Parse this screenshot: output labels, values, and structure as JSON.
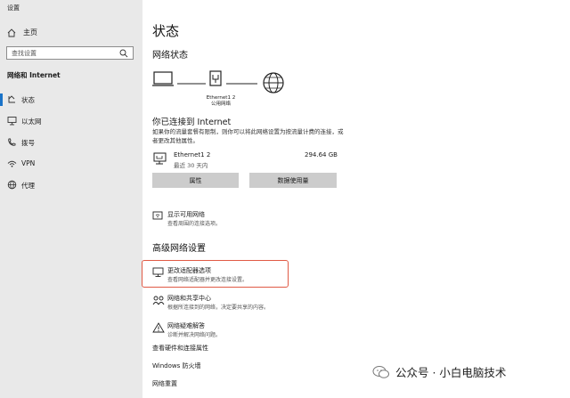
{
  "app": {
    "title": "设置"
  },
  "sidebar": {
    "home_label": "主页",
    "search_placeholder": "查找设置",
    "section_label": "网络和 Internet",
    "items": [
      {
        "label": "状态",
        "icon": "home-status-icon",
        "active": true
      },
      {
        "label": "以太网",
        "icon": "ethernet-icon",
        "active": false
      },
      {
        "label": "拨号",
        "icon": "dialup-phone-icon",
        "active": false
      },
      {
        "label": "VPN",
        "icon": "vpn-icon",
        "active": false
      },
      {
        "label": "代理",
        "icon": "proxy-globe-icon",
        "active": false
      }
    ]
  },
  "main": {
    "title": "状态",
    "network_status_heading": "网络状态",
    "diagram": {
      "adapter_name": "Ethernet1 2",
      "network_type": "公用网络"
    },
    "connected_title": "你已连接到 Internet",
    "connected_desc": "如果你的流量套餐有限制，则你可以将此网络设置为按流量计费的连接，或者更改其他属性。",
    "adapter": {
      "name": "Ethernet1 2",
      "sub": "最近 30 天内",
      "usage": "294.64 GB"
    },
    "buttons": {
      "properties": "属性",
      "data_usage": "数据使用量"
    },
    "show_networks": {
      "title": "显示可用网络",
      "sub": "查看周围的连接选项。"
    },
    "advanced_heading": "高级网络设置",
    "change_adapter": {
      "title": "更改适配器选项",
      "sub": "查看网络适配器并更改连接设置。"
    },
    "sharing_center": {
      "title": "网络和共享中心",
      "sub": "根据所连接到的网络，决定要共享的内容。"
    },
    "troubleshooter": {
      "title": "网络疑难解答",
      "sub": "诊断并解决网络问题。"
    },
    "links": [
      "查看硬件和连接属性",
      "Windows 防火墙",
      "网络重置"
    ]
  },
  "watermark": {
    "text": "公众号 · 小白电脑技术"
  }
}
